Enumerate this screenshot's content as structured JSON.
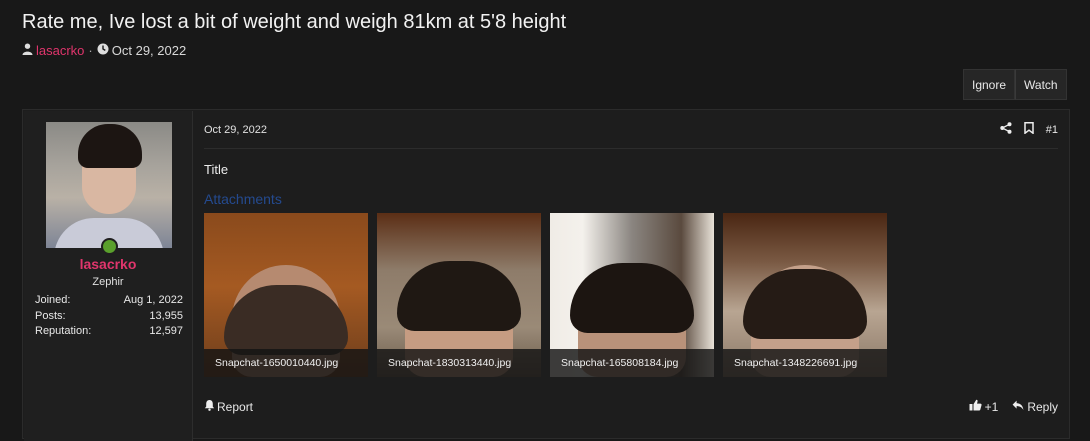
{
  "thread": {
    "title": "Rate me, Ive lost a bit of weight and weigh 81km at 5'8 height",
    "author": "lasacrko",
    "separator": "·",
    "date": "Oct 29, 2022"
  },
  "actions": {
    "ignore": "Ignore",
    "watch": "Watch"
  },
  "post": {
    "date": "Oct 29, 2022",
    "number": "#1",
    "body": "Title",
    "attachments_heading": "Attachments",
    "attachments": [
      {
        "filename": "Snapchat-1650010440.jpg"
      },
      {
        "filename": "Snapchat-1830313440.jpg"
      },
      {
        "filename": "Snapchat-165808184.jpg"
      },
      {
        "filename": "Snapchat-1348226691.jpg"
      }
    ],
    "report_label": "Report",
    "react_label": "+1",
    "reply_label": "Reply"
  },
  "user": {
    "name": "lasacrko",
    "title": "Zephir",
    "stats": [
      {
        "label": "Joined:",
        "value": "Aug 1, 2022"
      },
      {
        "label": "Posts:",
        "value": "13,955"
      },
      {
        "label": "Reputation:",
        "value": "12,597"
      }
    ]
  },
  "colors": {
    "background": "#181818",
    "username": "#e0356c",
    "attachments_heading": "#244a8f",
    "online": "#5aa02c"
  },
  "icons": [
    "user-icon",
    "clock-icon",
    "share-icon",
    "bookmark-icon",
    "bell-icon",
    "thumbs-up-icon",
    "reply-icon"
  ]
}
